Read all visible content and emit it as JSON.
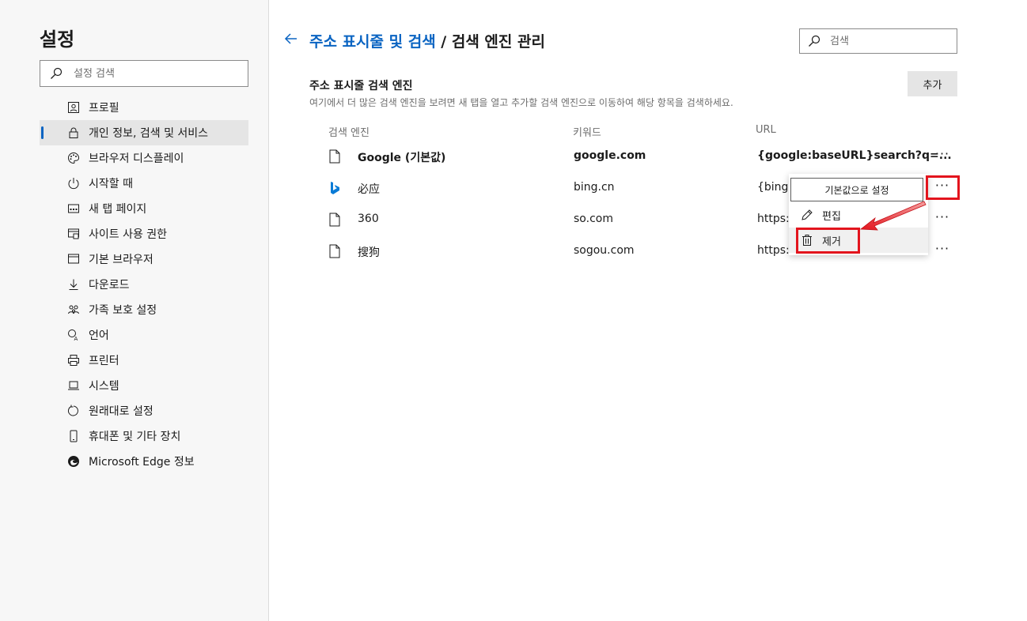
{
  "sidebar": {
    "title": "설정",
    "search_placeholder": "설정 검색",
    "items": [
      {
        "label": "프로필",
        "icon": "profile-icon"
      },
      {
        "label": "개인 정보, 검색 및 서비스",
        "icon": "lock-icon",
        "active": true
      },
      {
        "label": "브라우저 디스플레이",
        "icon": "palette-icon"
      },
      {
        "label": "시작할 때",
        "icon": "power-icon"
      },
      {
        "label": "새 탭 페이지",
        "icon": "new-tab-icon"
      },
      {
        "label": "사이트 사용 권한",
        "icon": "site-permissions-icon"
      },
      {
        "label": "기본 브라우저",
        "icon": "default-browser-icon"
      },
      {
        "label": "다운로드",
        "icon": "download-icon"
      },
      {
        "label": "가족 보호 설정",
        "icon": "family-icon"
      },
      {
        "label": "언어",
        "icon": "language-icon"
      },
      {
        "label": "프린터",
        "icon": "printer-icon"
      },
      {
        "label": "시스템",
        "icon": "system-icon"
      },
      {
        "label": "원래대로 설정",
        "icon": "reset-icon"
      },
      {
        "label": "휴대폰 및 기타 장치",
        "icon": "phone-icon"
      },
      {
        "label": "Microsoft Edge 정보",
        "icon": "edge-icon"
      }
    ]
  },
  "main": {
    "breadcrumb_link": "주소 표시줄 및 검색",
    "breadcrumb_sep": " / ",
    "breadcrumb_current": "검색 엔진 관리",
    "search_placeholder": "검색",
    "section_title": "주소 표시줄 검색 엔진",
    "section_desc": "여기에서 더 많은 검색 엔진을 보려면 새 탭을 열고 추가할 검색 엔진으로 이동하여 해당 항목을 검색하세요.",
    "add_label": "추가",
    "columns": {
      "engine": "검색 엔진",
      "keyword": "키워드",
      "url": "URL"
    },
    "engines": [
      {
        "name": "Google (기본값)",
        "keyword": "google.com",
        "url": "{google:baseURL}search?q=...",
        "icon": "page-icon",
        "more": "···"
      },
      {
        "name": "必应",
        "keyword": "bing.cn",
        "url": "{bing:b",
        "icon": "bing-icon",
        "more": "···"
      },
      {
        "name": "360",
        "keyword": "so.com",
        "url": "https:/",
        "icon": "page-icon",
        "more": "···"
      },
      {
        "name": "搜狗",
        "keyword": "sogou.com",
        "url": "https:/",
        "icon": "page-icon",
        "more": "···"
      }
    ]
  },
  "context_menu": {
    "set_default": "기본값으로 설정",
    "edit": "편집",
    "remove": "제거"
  },
  "colors": {
    "accent": "#0a64c2",
    "highlight": "#e3141d"
  }
}
